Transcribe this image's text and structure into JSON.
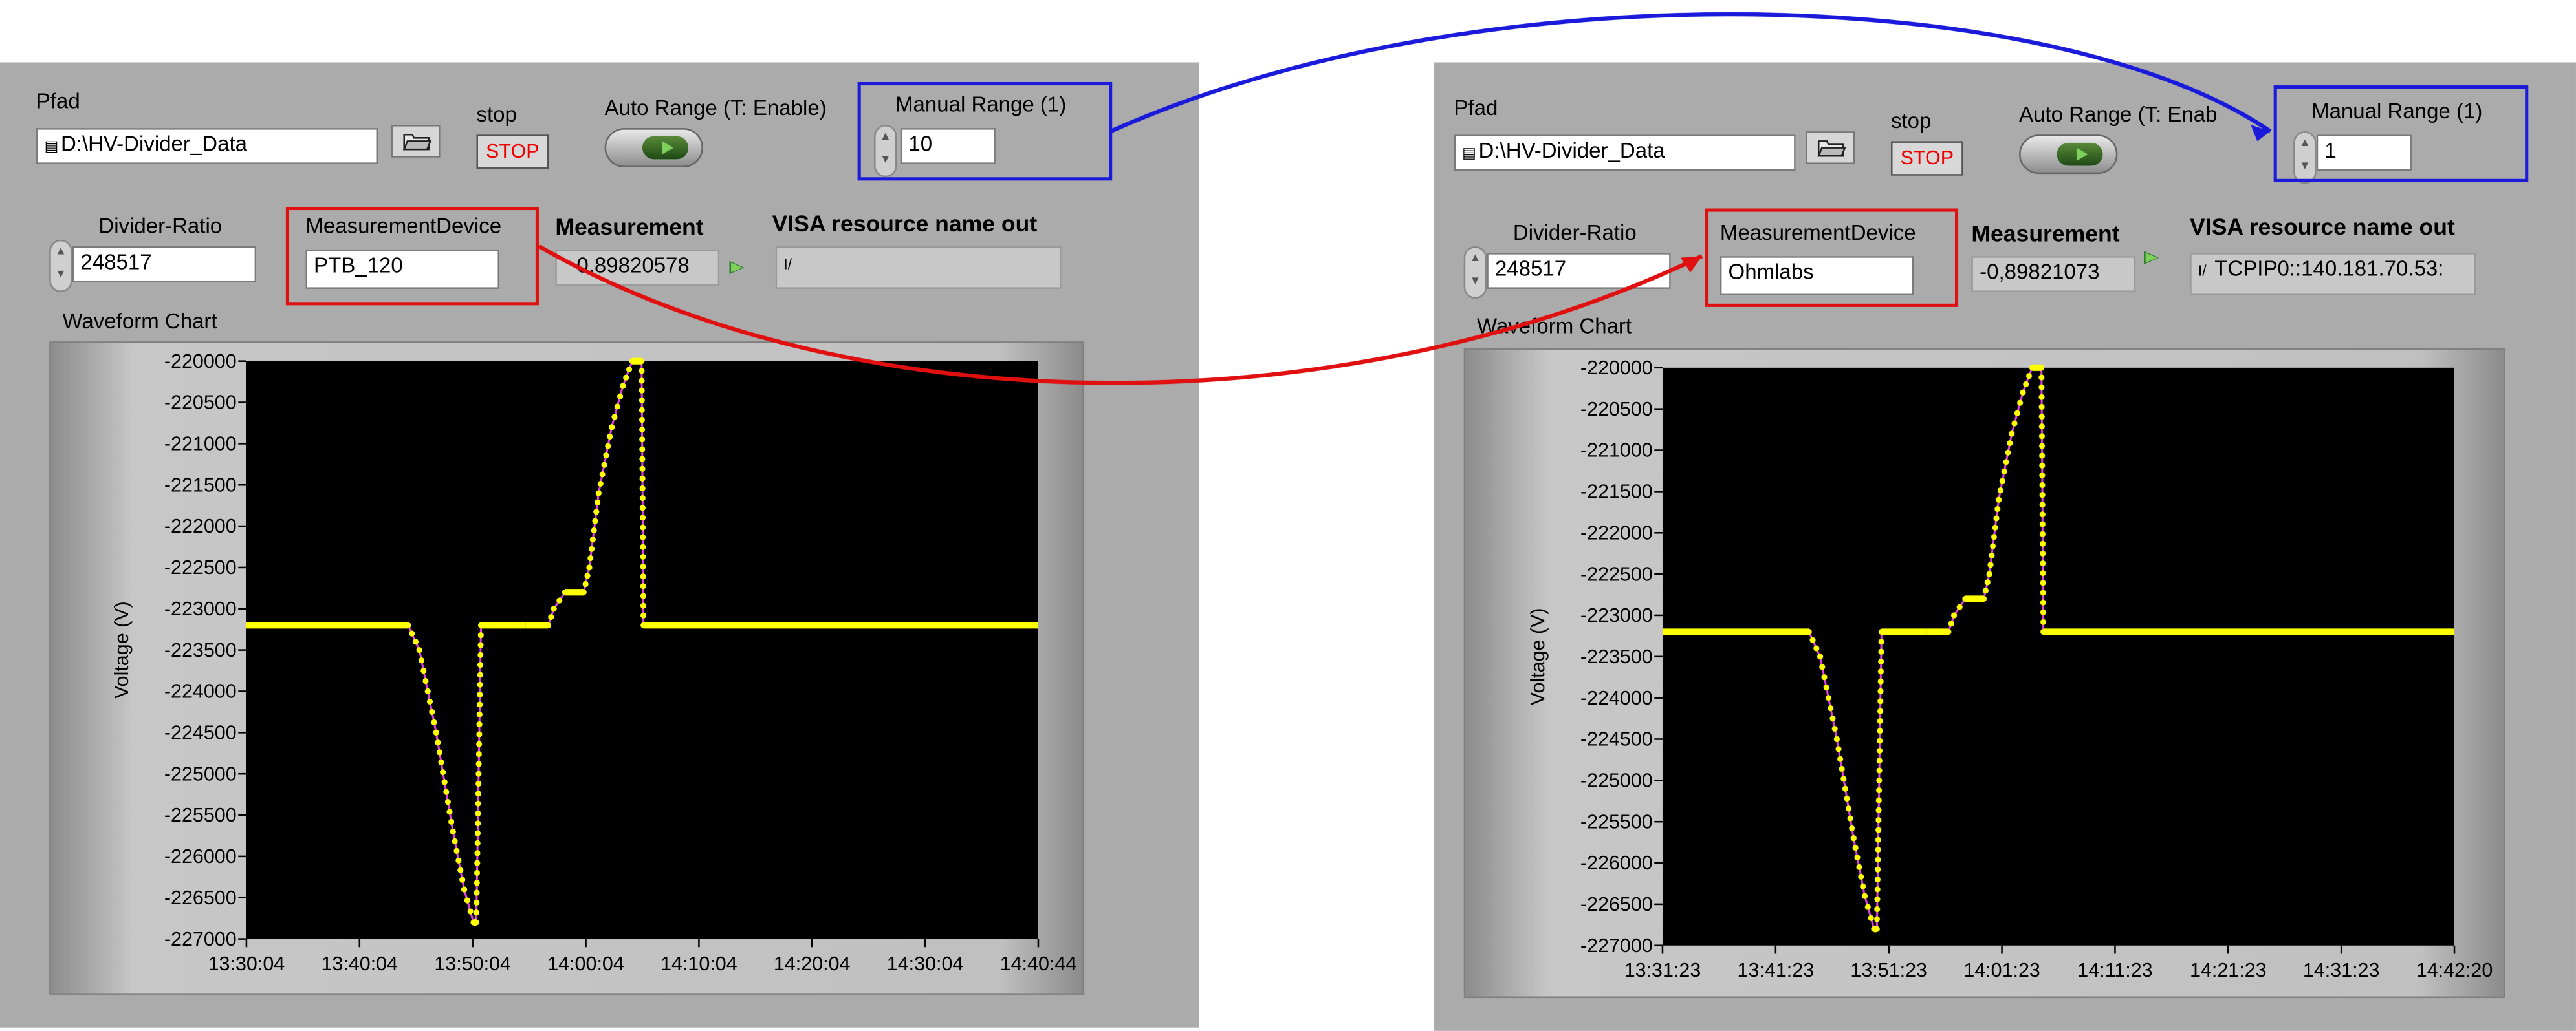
{
  "left_panel": {
    "path_label": "Pfad",
    "path_value": "D:\\HV-Divider_Data",
    "stop_label": "stop",
    "stop_button": "STOP",
    "auto_range_label": "Auto Range (T: Enable)",
    "manual_range_label": "Manual Range (1)",
    "manual_range_value": "10",
    "divider_ratio_label": "Divider-Ratio",
    "divider_ratio_value": "248517",
    "measurement_device_label": "MeasurementDevice",
    "measurement_device_value": "PTB_120",
    "measurement_label": "Measurement",
    "measurement_value": "0,89820578",
    "visa_label": "VISA resource name out",
    "visa_value": "",
    "chart_title": "Waveform Chart"
  },
  "right_panel": {
    "path_label": "Pfad",
    "path_value": "D:\\HV-Divider_Data",
    "stop_label": "stop",
    "stop_button": "STOP",
    "auto_range_label": "Auto Range (T: Enab",
    "manual_range_label": "Manual Range (1)",
    "manual_range_value": "1",
    "divider_ratio_label": "Divider-Ratio",
    "divider_ratio_value": "248517",
    "measurement_device_label": "MeasurementDevice",
    "measurement_device_value": "Ohmlabs",
    "measurement_label": "Measurement",
    "measurement_value": "-0,89821073",
    "visa_label": "VISA resource name out",
    "visa_value": "TCPIP0::140.181.70.53:",
    "chart_title": "Waveform Chart"
  },
  "colors": {
    "panel": "#ababab",
    "chart_bg": "#000000",
    "trace": "#ffff00",
    "trace_points": "#e040e0",
    "highlight_manual_range": "#1a1adb",
    "highlight_device": "#e01010"
  },
  "icons": [
    "folder-open-icon",
    "path-icon",
    "visa-icon",
    "toggle-led-icon"
  ],
  "chart_data": [
    {
      "type": "line",
      "title": "",
      "xlabel": "",
      "ylabel": "Voltage (V)",
      "ylim": [
        -227000,
        -220000
      ],
      "y_ticks": [
        "-220000",
        "-220500",
        "-221000",
        "-221500",
        "-222000",
        "-222500",
        "-223000",
        "-223500",
        "-224000",
        "-224500",
        "-225000",
        "-225500",
        "-226000",
        "-226500",
        "-227000"
      ],
      "x_ticks": [
        "13:30:04",
        "13:40:04",
        "13:50:04",
        "14:00:04",
        "14:10:04",
        "14:20:04",
        "14:30:04",
        "14:40:44"
      ],
      "xlim": [
        "13:30:04",
        "14:40:44"
      ],
      "series": [
        {
          "x": [
            "13:30:04",
            "13:44:30",
            "13:45:30",
            "13:47:00",
            "13:48:30",
            "13:49:30",
            "13:50:20",
            "13:50:35",
            "13:51:00",
            "13:55:00",
            "13:57:00",
            "13:57:30",
            "13:58:30",
            "14:00:10",
            "14:00:40",
            "14:01:30",
            "14:02:40",
            "14:03:40",
            "14:04:30",
            "14:05:20",
            "14:05:30",
            "14:40:44"
          ],
          "y": [
            -223200,
            -223200,
            -223500,
            -224500,
            -225700,
            -226400,
            -226800,
            -226800,
            -223200,
            -223200,
            -223200,
            -223000,
            -222800,
            -222800,
            -222500,
            -221600,
            -220800,
            -220300,
            -220000,
            -220000,
            -223200,
            -223200
          ]
        }
      ]
    },
    {
      "type": "line",
      "title": "",
      "xlabel": "",
      "ylabel": "Voltage (V)",
      "ylim": [
        -227000,
        -220000
      ],
      "y_ticks": [
        "-220000",
        "-220500",
        "-221000",
        "-221500",
        "-222000",
        "-222500",
        "-223000",
        "-223500",
        "-224000",
        "-224500",
        "-225000",
        "-225500",
        "-226000",
        "-226500",
        "-227000"
      ],
      "x_ticks": [
        "13:31:23",
        "13:41:23",
        "13:51:23",
        "14:01:23",
        "14:11:23",
        "14:21:23",
        "14:31:23",
        "14:42:20"
      ],
      "xlim": [
        "13:31:23",
        "14:42:20"
      ],
      "series": [
        {
          "x": [
            "13:31:23",
            "13:44:30",
            "13:45:30",
            "13:47:00",
            "13:48:30",
            "13:49:30",
            "13:50:20",
            "13:50:35",
            "13:51:00",
            "13:55:00",
            "13:57:00",
            "13:57:30",
            "13:58:30",
            "14:00:10",
            "14:00:40",
            "14:01:30",
            "14:02:40",
            "14:03:40",
            "14:04:30",
            "14:05:20",
            "14:05:30",
            "14:42:20"
          ],
          "y": [
            -223200,
            -223200,
            -223500,
            -224500,
            -225700,
            -226400,
            -226800,
            -226800,
            -223200,
            -223200,
            -223200,
            -223000,
            -222800,
            -222800,
            -222500,
            -221600,
            -220800,
            -220300,
            -220000,
            -220000,
            -223200,
            -223200
          ]
        }
      ]
    }
  ]
}
